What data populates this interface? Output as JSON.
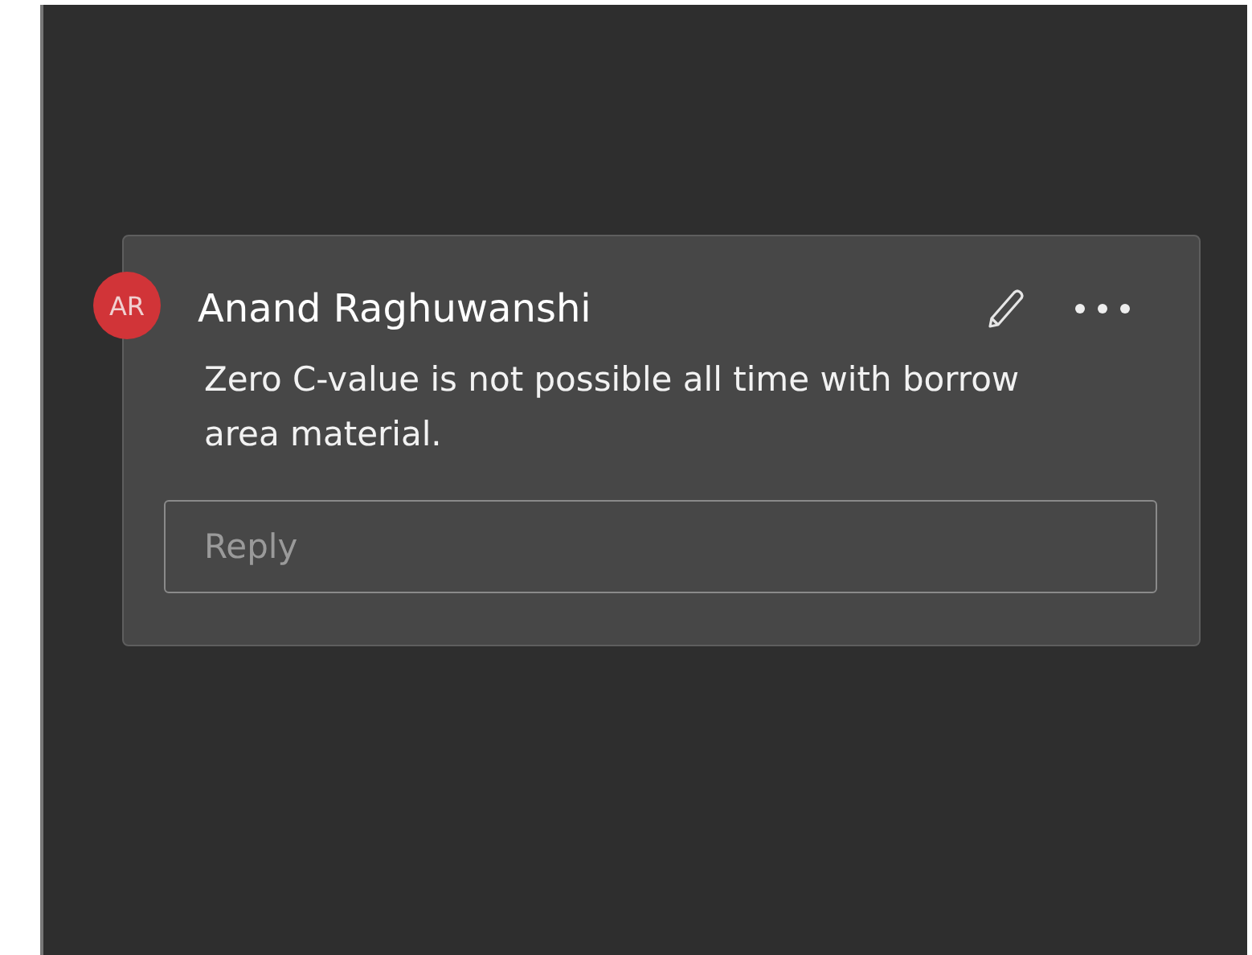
{
  "comment": {
    "avatar_initials": "AR",
    "author": "Anand Raghuwanshi",
    "text": "Zero C-value is not possible all time with borrow area material."
  },
  "reply": {
    "placeholder": "Reply"
  }
}
